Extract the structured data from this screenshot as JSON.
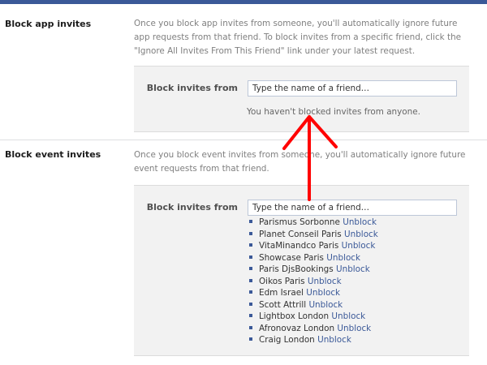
{
  "sections": [
    {
      "title": "Block app invites",
      "description": "Once you block app invites from someone, you'll automatically ignore future app requests from that friend. To block invites from a specific friend, click the \"Ignore All Invites From This Friend\" link under your latest request.",
      "field_label": "Block invites from",
      "input_placeholder": "Type the name of a friend…",
      "empty_message": "You haven't blocked invites from anyone."
    },
    {
      "title": "Block event invites",
      "description": "Once you block event invites from someone, you'll automatically ignore future event requests from that friend.",
      "field_label": "Block invites from",
      "input_placeholder": "Type the name of a friend…",
      "unblock_label": "Unblock",
      "blocked": [
        "Parismus Sorbonne",
        "Planet Conseil Paris",
        "VitaMinandco Paris",
        "Showcase Paris",
        "Paris DjsBookings",
        "Oikos Paris",
        "Edm Israel",
        "Scott Attrill",
        "Lightbox London",
        "Afronovaz London",
        "Craig London"
      ]
    }
  ],
  "colors": {
    "header": "#3b5998",
    "link": "#3b5998",
    "panel": "#f2f2f2",
    "annotation_arrow": "#ff0000"
  }
}
